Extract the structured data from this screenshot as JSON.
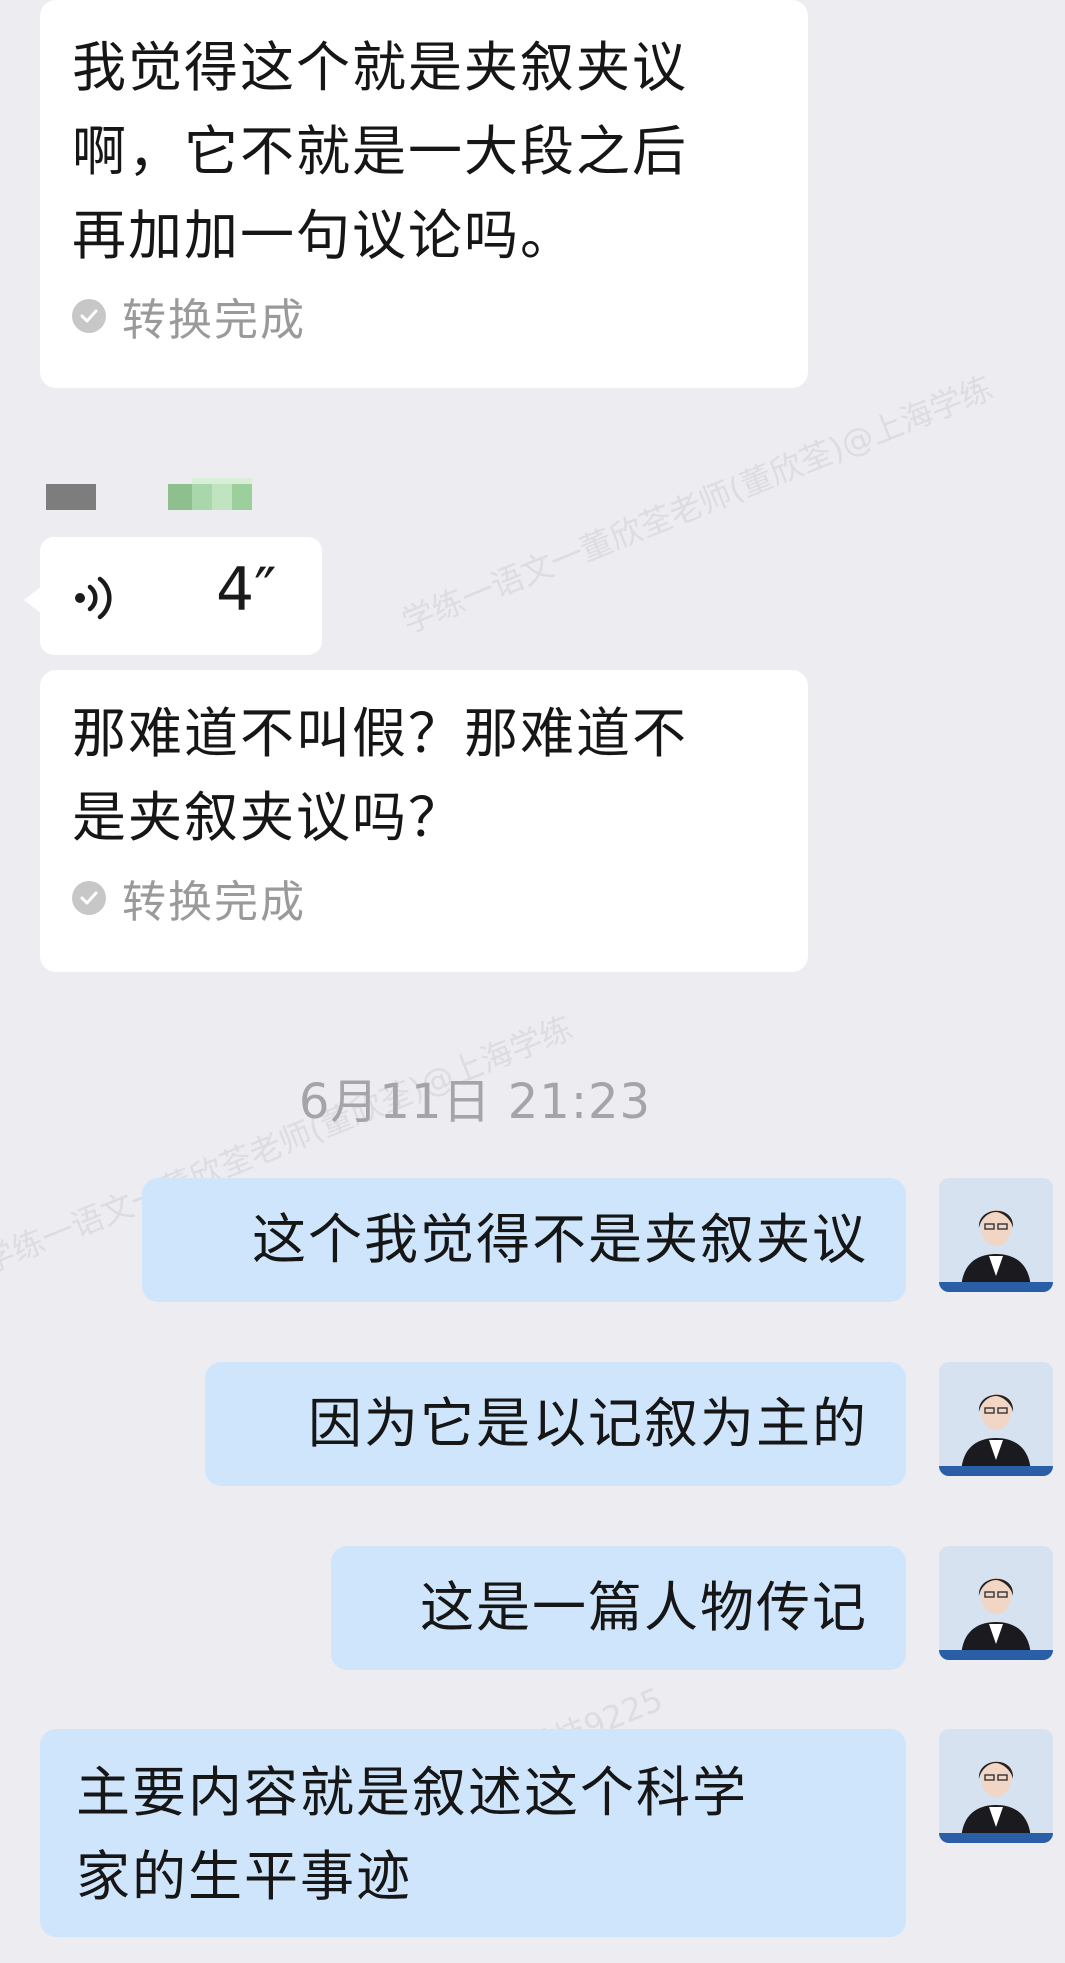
{
  "messages_top": [
    {
      "text": "我觉得这个就是夹叙夹议\n啊，它不就是一大段之后\n再加加一句议论吗。",
      "status": "转换完成"
    }
  ],
  "voice_message": {
    "duration": "4″"
  },
  "voice_transcript": {
    "text": "那难道不叫假？那难道不\n是夹叙夹议吗？",
    "status": "转换完成"
  },
  "timestamp": "6月11日   21:23",
  "outgoing": [
    {
      "text": "这个我觉得不是夹叙夹议"
    },
    {
      "text": "因为它是以记叙为主的"
    },
    {
      "text": "这是一篇人物传记"
    },
    {
      "text": "主要内容就是叙述这个科学\n家的生平事迹"
    }
  ],
  "watermark": {
    "a": "学练一语文一董欣荃老师(董欣荃)@上海学练",
    "b": "学练一语文一董欣荃老师(董欣荃)@上海学练",
    "c": "科技9225"
  },
  "colors": {
    "background": "#ededf1",
    "incoming_bubble": "#ffffff",
    "outgoing_bubble": "#cfe5fc"
  }
}
